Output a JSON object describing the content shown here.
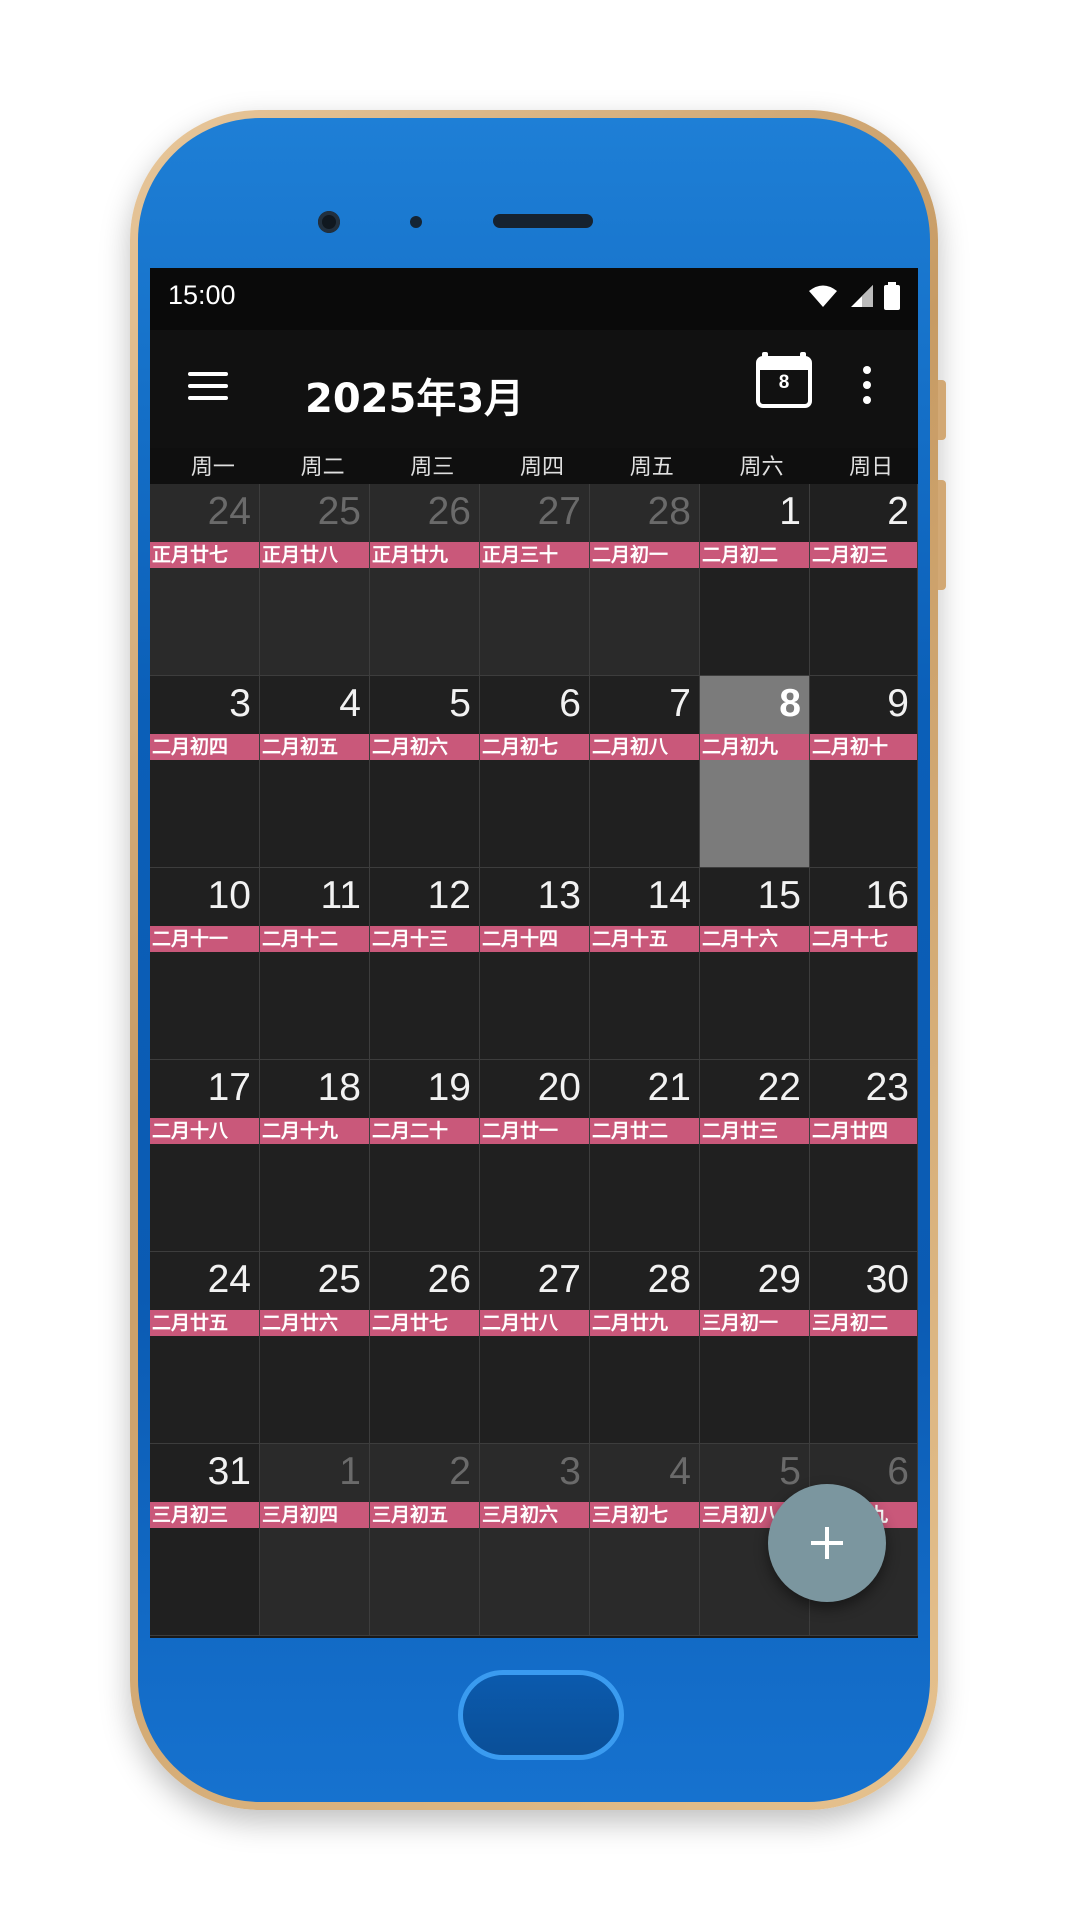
{
  "status_bar": {
    "time": "15:00"
  },
  "app_bar": {
    "title": "2025年3月",
    "today_icon_day": "8"
  },
  "weekdays": [
    "周一",
    "周二",
    "周三",
    "周四",
    "周五",
    "周六",
    "周日"
  ],
  "weeks": [
    [
      {
        "day": "24",
        "lunar": "正月廿七",
        "in_month": false
      },
      {
        "day": "25",
        "lunar": "正月廿八",
        "in_month": false
      },
      {
        "day": "26",
        "lunar": "正月廿九",
        "in_month": false
      },
      {
        "day": "27",
        "lunar": "正月三十",
        "in_month": false
      },
      {
        "day": "28",
        "lunar": "二月初一",
        "in_month": false
      },
      {
        "day": "1",
        "lunar": "二月初二",
        "in_month": true
      },
      {
        "day": "2",
        "lunar": "二月初三",
        "in_month": true
      }
    ],
    [
      {
        "day": "3",
        "lunar": "二月初四",
        "in_month": true
      },
      {
        "day": "4",
        "lunar": "二月初五",
        "in_month": true
      },
      {
        "day": "5",
        "lunar": "二月初六",
        "in_month": true
      },
      {
        "day": "6",
        "lunar": "二月初七",
        "in_month": true
      },
      {
        "day": "7",
        "lunar": "二月初八",
        "in_month": true
      },
      {
        "day": "8",
        "lunar": "二月初九",
        "in_month": true,
        "today": true
      },
      {
        "day": "9",
        "lunar": "二月初十",
        "in_month": true
      }
    ],
    [
      {
        "day": "10",
        "lunar": "二月十一",
        "in_month": true
      },
      {
        "day": "11",
        "lunar": "二月十二",
        "in_month": true
      },
      {
        "day": "12",
        "lunar": "二月十三",
        "in_month": true
      },
      {
        "day": "13",
        "lunar": "二月十四",
        "in_month": true
      },
      {
        "day": "14",
        "lunar": "二月十五",
        "in_month": true
      },
      {
        "day": "15",
        "lunar": "二月十六",
        "in_month": true
      },
      {
        "day": "16",
        "lunar": "二月十七",
        "in_month": true
      }
    ],
    [
      {
        "day": "17",
        "lunar": "二月十八",
        "in_month": true
      },
      {
        "day": "18",
        "lunar": "二月十九",
        "in_month": true
      },
      {
        "day": "19",
        "lunar": "二月二十",
        "in_month": true
      },
      {
        "day": "20",
        "lunar": "二月廿一",
        "in_month": true
      },
      {
        "day": "21",
        "lunar": "二月廿二",
        "in_month": true
      },
      {
        "day": "22",
        "lunar": "二月廿三",
        "in_month": true
      },
      {
        "day": "23",
        "lunar": "二月廿四",
        "in_month": true
      }
    ],
    [
      {
        "day": "24",
        "lunar": "二月廿五",
        "in_month": true
      },
      {
        "day": "25",
        "lunar": "二月廿六",
        "in_month": true
      },
      {
        "day": "26",
        "lunar": "二月廿七",
        "in_month": true
      },
      {
        "day": "27",
        "lunar": "二月廿八",
        "in_month": true
      },
      {
        "day": "28",
        "lunar": "二月廿九",
        "in_month": true
      },
      {
        "day": "29",
        "lunar": "三月初一",
        "in_month": true
      },
      {
        "day": "30",
        "lunar": "三月初二",
        "in_month": true
      }
    ],
    [
      {
        "day": "31",
        "lunar": "三月初三",
        "in_month": true
      },
      {
        "day": "1",
        "lunar": "三月初四",
        "in_month": false
      },
      {
        "day": "2",
        "lunar": "三月初五",
        "in_month": false
      },
      {
        "day": "3",
        "lunar": "三月初六",
        "in_month": false
      },
      {
        "day": "4",
        "lunar": "三月初七",
        "in_month": false
      },
      {
        "day": "5",
        "lunar": "三月初八",
        "in_month": false
      },
      {
        "day": "6",
        "lunar": "三月初九",
        "in_month": false
      }
    ]
  ],
  "colors": {
    "lunar_band": "#c9587a",
    "today_cell": "#7b7b7b",
    "fab": "#7b969f",
    "phone_body": "#0b5fb8"
  },
  "icons": {
    "menu": "menu-icon",
    "today": "calendar-today-icon",
    "more": "more-vert-icon",
    "fab": "add-icon"
  }
}
